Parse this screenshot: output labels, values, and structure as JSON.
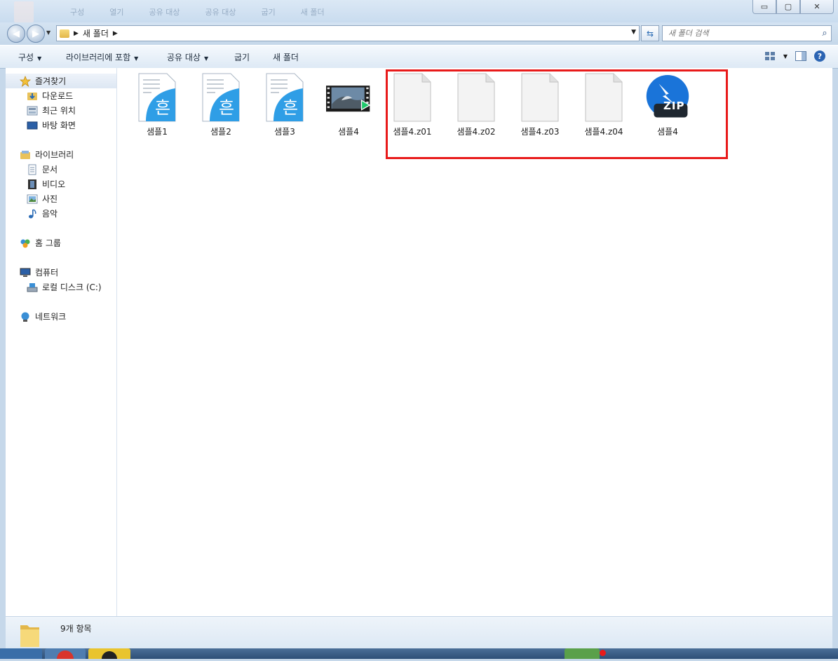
{
  "window": {
    "ghost_toolbar": [
      "구성",
      "열기",
      "공유 대상",
      "공유 대상",
      "굽기",
      "새 폴더"
    ],
    "buttons": {
      "minimize": "▭",
      "maximize": "▢",
      "close": "✕"
    }
  },
  "address": {
    "crumbs": [
      "새 폴더"
    ],
    "search_placeholder": "새 폴더 검색"
  },
  "commands": {
    "organize": "구성",
    "include_library": "라이브러리에 포함",
    "share_with": "공유 대상",
    "burn": "굽기",
    "new_folder": "새 폴더"
  },
  "nav": {
    "favorites": {
      "label": "즐겨찾기",
      "items": [
        "다운로드",
        "최근 위치",
        "바탕 화면"
      ]
    },
    "libraries": {
      "label": "라이브러리",
      "items": [
        "문서",
        "비디오",
        "사진",
        "음악"
      ]
    },
    "homegroup": {
      "label": "홈 그룹"
    },
    "computer": {
      "label": "컴퓨터",
      "items": [
        "로컬 디스크 (C:)"
      ]
    },
    "network": {
      "label": "네트워크"
    }
  },
  "files": [
    {
      "name": "샘플1",
      "type": "hwp-icon"
    },
    {
      "name": "샘플2",
      "type": "hwp-icon"
    },
    {
      "name": "샘플3",
      "type": "hwp-icon"
    },
    {
      "name": "샘플4",
      "type": "video-icon"
    },
    {
      "name": "샘플4.z01",
      "type": "blank-file-icon"
    },
    {
      "name": "샘플4.z02",
      "type": "blank-file-icon"
    },
    {
      "name": "샘플4.z03",
      "type": "blank-file-icon"
    },
    {
      "name": "샘플4.z04",
      "type": "blank-file-icon"
    },
    {
      "name": "샘플4",
      "type": "zip-icon",
      "badge": "ZIP"
    }
  ],
  "status": {
    "count_text": "9개 항목"
  },
  "colors": {
    "highlight": "#e81a1a",
    "hwp_blue": "#2f9ee6",
    "zip_blue": "#1a74d9"
  }
}
